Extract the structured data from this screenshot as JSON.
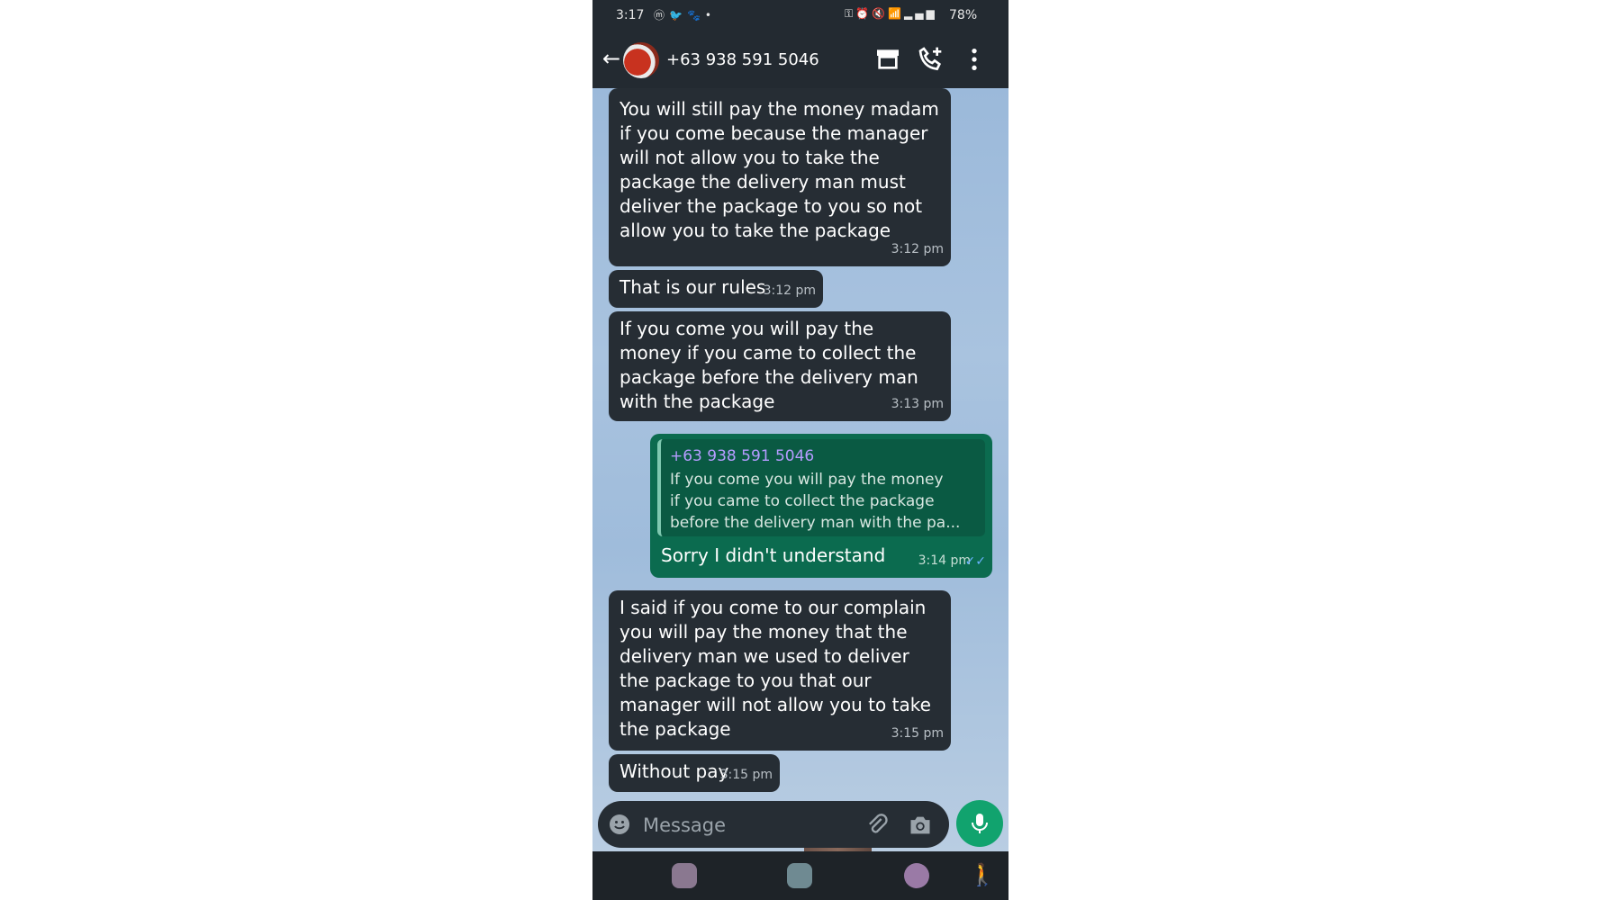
{
  "status_bar": {
    "time": "3:17",
    "left_icons": [
      "messenger-icon",
      "twitter-icon",
      "paw-icon",
      "dot-icon"
    ],
    "right_icons": [
      "key-icon",
      "alarm-icon",
      "mute-icon",
      "wifi-icon",
      "signal-icon"
    ],
    "battery": "78%"
  },
  "header": {
    "contact_name": "+63 938 591 5046",
    "actions": [
      "store-icon",
      "add-call-icon",
      "more-icon"
    ]
  },
  "messages": [
    {
      "direction": "in",
      "text": "You will still pay the money madam if you come because the manager will not allow  you to take the package the delivery man must deliver the package to you so not allow you to take the package",
      "time": "3:12 pm"
    },
    {
      "direction": "in",
      "text": "That is our rules",
      "time": "3:12 pm"
    },
    {
      "direction": "in",
      "text": "If you come you will pay the money if you came to collect the package before the delivery man with the package",
      "time": "3:13 pm"
    },
    {
      "direction": "out",
      "reply_to": {
        "name": "+63 938 591 5046",
        "lines": [
          "If you come you will pay the money",
          "if you came to collect the package",
          "before the delivery man with the pa..."
        ]
      },
      "text": "Sorry I didn't understand",
      "time": "3:14 pm",
      "status": "read"
    },
    {
      "direction": "in",
      "text": "I said if you come to our complain you will pay the money that the delivery man we used to deliver the package to you that our manager will not allow you to take the package",
      "time": "3:15 pm"
    },
    {
      "direction": "in",
      "text": "Without pay",
      "time": "3:15 pm"
    }
  ],
  "composer": {
    "placeholder": "Message",
    "icons": [
      "emoji-icon",
      "attach-icon",
      "camera-icon",
      "mic-icon"
    ]
  },
  "nav_bar": [
    "recents-button",
    "home-button",
    "back-button",
    "accessibility-button"
  ],
  "colors": {
    "bar_bg": "#232a31",
    "incoming_bubble": "#262d34",
    "outgoing_bubble": "#0b6b4f",
    "mic_button": "#11a36e"
  }
}
